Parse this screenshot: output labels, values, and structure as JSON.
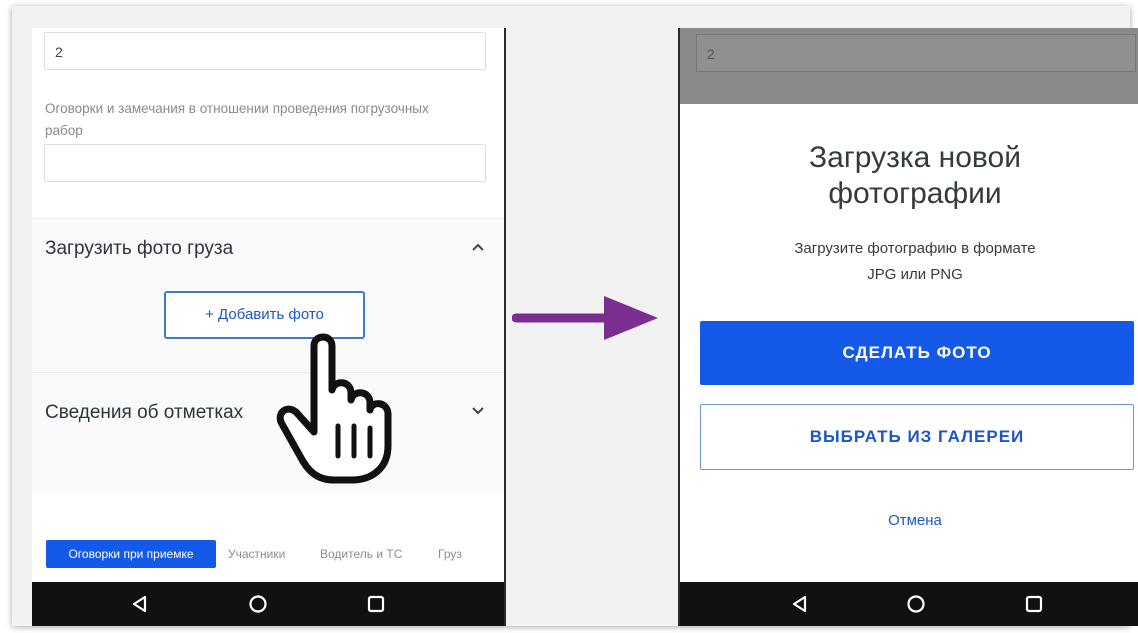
{
  "left_screen": {
    "quantity_value": "2",
    "remarks_label": "Оговорки и замечания в отношении проведения погрузочных рабор",
    "remarks_value": "",
    "upload_section": {
      "title": "Загрузить фото груза",
      "add_photo_label": "+ Добавить фото",
      "chevron": "chevron-up-icon"
    },
    "marks_section": {
      "title": "Сведения об отметках",
      "chevron": "chevron-down-icon"
    },
    "tabs": [
      {
        "label": "Оговорки при приемке",
        "active": true
      },
      {
        "label": "Участники",
        "active": false
      },
      {
        "label": "Водитель и ТС",
        "active": false
      },
      {
        "label": "Груз",
        "active": false
      }
    ],
    "cursor": "hand-pointer-icon"
  },
  "transition_arrow": {
    "icon": "arrow-right-icon",
    "color": "#7a2e8f"
  },
  "right_screen": {
    "background_value": "2",
    "dialog": {
      "title": "Загрузка новой фотографии",
      "subtitle_line1": "Загрузите фотографию в формате",
      "subtitle_line2": "JPG или PNG",
      "primary_button": "СДЕЛАТЬ ФОТО",
      "secondary_button": "ВЫБРАТЬ ИЗ ГАЛЕРЕИ",
      "cancel_link": "Отмена"
    }
  },
  "android_nav": {
    "back": "back-triangle-icon",
    "home": "home-circle-icon",
    "recents": "recents-square-icon"
  },
  "colors": {
    "accent": "#1559e8",
    "link": "#1d56c7",
    "arrow": "#7a2e8f",
    "navbar": "#111111"
  }
}
